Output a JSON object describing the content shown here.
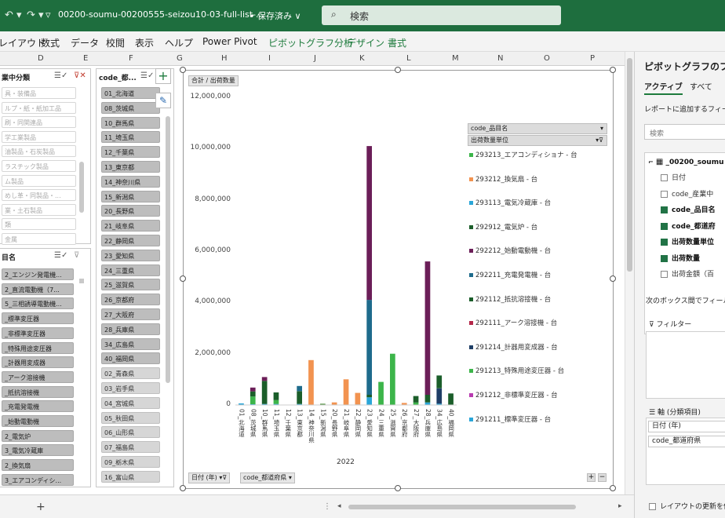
{
  "titlebar": {
    "undo": "↶ ▾",
    "redo": "↷ ▾",
    "qat_more": "▿",
    "filename": "00200-soumu-00200555-seizou10-03-full-list-...",
    "saved": "• 保存済み ∨",
    "search_placeholder": "検索",
    "search_icon": "⌕"
  },
  "ribbon": {
    "tabs": [
      "レイアウト",
      "数式",
      "データ",
      "校閲",
      "表示",
      "ヘルプ",
      "Power Pivot",
      "ピボットグラフ分析",
      "デザイン",
      "書式"
    ]
  },
  "columns": [
    "D",
    "E",
    "F",
    "G",
    "H",
    "I",
    "J",
    "K",
    "L",
    "M",
    "N",
    "O",
    "P"
  ],
  "slicer1": {
    "title": "業中分類",
    "items": [
      "具・装備品",
      "ルプ・紙・紙加工品",
      "刷・同関連品",
      "学工業製品",
      "油製品・石炭製品",
      "ラスチック製品",
      "ム製品",
      "めし革・同製品・...",
      "業・土石製品",
      "類",
      "金属"
    ]
  },
  "slicer2": {
    "title": "目名",
    "items": [
      "2_エンジン発電機...",
      "2_直流電動機（7...",
      "5_三相誘導電動機...",
      "_標準変圧器",
      "_非標準変圧器",
      "_特殊用途変圧器",
      "_計器用変成器",
      "_アーク溶接機",
      "_抵抗溶接機",
      "_充電発電機",
      "_始動電動機",
      "2_電気炉",
      "3_電気冷蔵庫",
      "2_換気扇",
      "3_エアコンディシ..."
    ]
  },
  "slicer3": {
    "title": "code_都...",
    "items": [
      "01_北海道",
      "08_茨城県",
      "10_群馬県",
      "11_埼玉県",
      "12_千葉県",
      "13_東京都",
      "14_神奈川県",
      "15_新潟県",
      "20_長野県",
      "21_岐阜県",
      "22_静岡県",
      "23_愛知県",
      "24_三重県",
      "25_滋賀県",
      "26_京都府",
      "27_大阪府",
      "28_兵庫県",
      "34_広島県",
      "40_福岡県",
      "02_青森県",
      "03_岩手県",
      "04_宮城県",
      "05_秋田県",
      "06_山形県",
      "07_福島県",
      "09_栃木県",
      "16_富山県"
    ],
    "selected_count": 19
  },
  "chart": {
    "value_field": "合計 / 出荷数量",
    "legend_header1": "code_品目名",
    "legend_header2": "出荷数量単位",
    "axis_field1": "日付 (年)",
    "axis_field2": "code_都道府県",
    "year_label": "2022"
  },
  "chart_data": {
    "type": "bar",
    "stacked": true,
    "title": "",
    "ylim": [
      0,
      12000000
    ],
    "yticks": [
      "0",
      "2,000,000",
      "4,000,000",
      "6,000,000",
      "8,000,000",
      "10,000,000",
      "12,000,000"
    ],
    "categories": [
      "01_北海道",
      "08_茨城県",
      "10_群馬県",
      "11_埼玉県",
      "12_千葉県",
      "13_東京都",
      "14_神奈川県",
      "15_新潟県",
      "20_長野県",
      "21_岐阜県",
      "22_静岡県",
      "23_愛知県",
      "24_三重県",
      "25_滋賀県",
      "26_京都府",
      "27_大阪府",
      "28_兵庫県",
      "34_広島県",
      "40_福岡県"
    ],
    "x_group": "2022",
    "series": [
      {
        "name": "291211_標準変圧器 - 台",
        "color": "#2aa6d8",
        "values": [
          60000,
          30000,
          40000,
          40000,
          0,
          40000,
          0,
          0,
          0,
          0,
          20000,
          300000,
          0,
          0,
          0,
          0,
          100000,
          50000,
          0
        ]
      },
      {
        "name": "291214_計器用変成器 - 台",
        "color": "#1f3e66",
        "values": [
          0,
          0,
          0,
          0,
          0,
          0,
          0,
          0,
          0,
          0,
          0,
          0,
          0,
          0,
          0,
          0,
          0,
          600000,
          0
        ]
      },
      {
        "name": "291213_特殊用途変圧器 - 台",
        "color": "#3cb54a",
        "values": [
          0,
          300000,
          0,
          150000,
          0,
          0,
          0,
          0,
          0,
          0,
          0,
          0,
          900000,
          2000000,
          0,
          100000,
          0,
          0,
          0
        ]
      },
      {
        "name": "292112_抵抗溶接機 - 台",
        "color": "#1b5e2a",
        "values": [
          0,
          200000,
          900000,
          300000,
          0,
          500000,
          0,
          0,
          0,
          0,
          0,
          100000,
          0,
          0,
          0,
          250000,
          300000,
          500000,
          450000
        ]
      },
      {
        "name": "292211_充電発電機 - 台",
        "color": "#1e6b8c",
        "values": [
          0,
          0,
          0,
          0,
          0,
          200000,
          0,
          0,
          0,
          0,
          0,
          3700000,
          0,
          0,
          0,
          0,
          0,
          0,
          0
        ]
      },
      {
        "name": "292212_始動電動機 - 台",
        "color": "#6b1e58",
        "values": [
          0,
          150000,
          150000,
          0,
          0,
          0,
          0,
          0,
          0,
          0,
          0,
          6000000,
          0,
          0,
          0,
          0,
          5200000,
          0,
          0
        ]
      },
      {
        "name": "293212_換気扇 - 台",
        "color": "#f29350",
        "values": [
          0,
          0,
          0,
          0,
          0,
          0,
          1750000,
          0,
          100000,
          1000000,
          450000,
          0,
          0,
          0,
          80000,
          0,
          0,
          0,
          0
        ]
      },
      {
        "name": "292912_電気炉 - 台",
        "color": "#4d8f3c",
        "values": [
          0,
          0,
          0,
          0,
          0,
          0,
          0,
          50000,
          0,
          0,
          0,
          0,
          0,
          0,
          0,
          0,
          0,
          0,
          0
        ]
      }
    ],
    "legend": [
      {
        "name": "293213_エアコンディショナ - 台",
        "color": "#3cb54a"
      },
      {
        "name": "293212_換気扇 - 台",
        "color": "#f29350"
      },
      {
        "name": "293113_電気冷蔵庫 - 台",
        "color": "#2aa6d8"
      },
      {
        "name": "292912_電気炉 - 台",
        "color": "#1b5e2a"
      },
      {
        "name": "292212_始動電動機 - 台",
        "color": "#6b1e58"
      },
      {
        "name": "292211_充電発電機 - 台",
        "color": "#1e6b8c"
      },
      {
        "name": "292112_抵抗溶接機 - 台",
        "color": "#1b5e2a"
      },
      {
        "name": "292111_アーク溶接機 - 台",
        "color": "#b5284a"
      },
      {
        "name": "291214_計器用変成器 - 台",
        "color": "#1f3e66"
      },
      {
        "name": "291213_特殊用途変圧器 - 台",
        "color": "#3cb54a"
      },
      {
        "name": "291212_非標準変圧器 - 台",
        "color": "#b83ab0"
      },
      {
        "name": "291211_標準変圧器 - 台",
        "color": "#2aa6d8"
      }
    ]
  },
  "pane": {
    "title": "ピボットグラフのフィー",
    "tab_active": "アクティブ",
    "tab_all": "すべて",
    "subtitle": "レポートに追加するフィール",
    "search_placeholder": "検索",
    "table_name": "_00200_soumu",
    "fields": [
      {
        "label": "日付",
        "checked": false
      },
      {
        "label": "code_産業中",
        "checked": false
      },
      {
        "label": "code_品目名",
        "checked": true
      },
      {
        "label": "code_都道府",
        "checked": true
      },
      {
        "label": "出荷数量単位",
        "checked": true
      },
      {
        "label": "出荷数量",
        "checked": true
      },
      {
        "label": "出荷金額（百",
        "checked": false
      }
    ],
    "drag_hint": "次のボックス間でフィールド",
    "filter_label": "フィルター",
    "axis_label": "軸 (分類項目)",
    "axis_items": [
      "日付 (年)",
      "code_都道府県"
    ],
    "defer_label": "レイアウトの更新を保"
  },
  "sheet": {
    "add_sheet": "+"
  }
}
